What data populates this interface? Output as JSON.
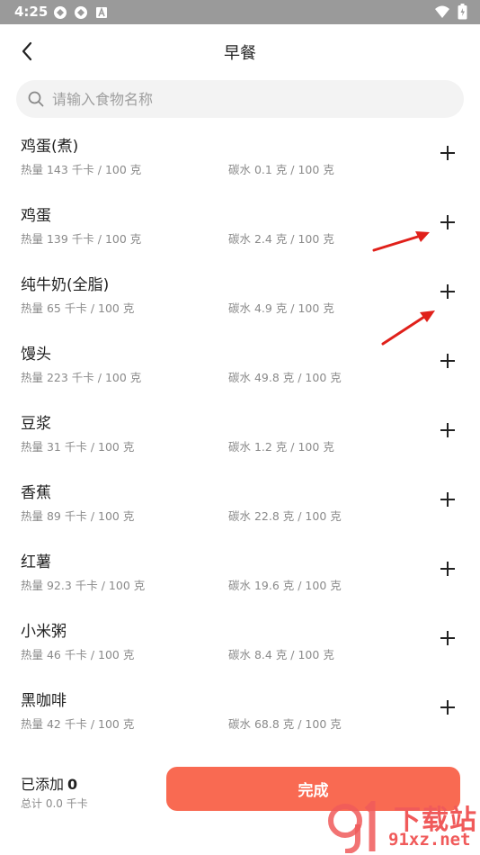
{
  "status_bar": {
    "time": "4:25"
  },
  "header": {
    "title": "早餐"
  },
  "search": {
    "placeholder": "请输入食物名称"
  },
  "foods": [
    {
      "name": "鸡蛋(煮)",
      "calories": "热量 143 千卡 / 100 克",
      "carbs": "碳水 0.1 克 / 100 克"
    },
    {
      "name": "鸡蛋",
      "calories": "热量 139 千卡 / 100 克",
      "carbs": "碳水 2.4 克 / 100 克"
    },
    {
      "name": "纯牛奶(全脂)",
      "calories": "热量 65 千卡 / 100 克",
      "carbs": "碳水 4.9 克 / 100 克"
    },
    {
      "name": "馒头",
      "calories": "热量 223 千卡 / 100 克",
      "carbs": "碳水 49.8 克 / 100 克"
    },
    {
      "name": "豆浆",
      "calories": "热量 31 千卡 / 100 克",
      "carbs": "碳水 1.2 克 / 100 克"
    },
    {
      "name": "香蕉",
      "calories": "热量 89 千卡 / 100 克",
      "carbs": "碳水 22.8 克 / 100 克"
    },
    {
      "name": "红薯",
      "calories": "热量 92.3 千卡 / 100 克",
      "carbs": "碳水 19.6 克 / 100 克"
    },
    {
      "name": "小米粥",
      "calories": "热量 46 千卡 / 100 克",
      "carbs": "碳水 8.4 克 / 100 克"
    },
    {
      "name": "黑咖啡",
      "calories": "热量 42 千卡 / 100 克",
      "carbs": "碳水 68.8 克 / 100 克"
    }
  ],
  "bottom": {
    "added_label": "已添加",
    "added_count": "0",
    "total": "总计 0.0 千卡",
    "done_label": "完成"
  },
  "watermark": {
    "top_text": "下载站",
    "bottom_text": "91xz.net"
  },
  "colors": {
    "accent": "#f96a52",
    "arrow": "#e0201a",
    "status_bar": "#9a9a9a"
  }
}
